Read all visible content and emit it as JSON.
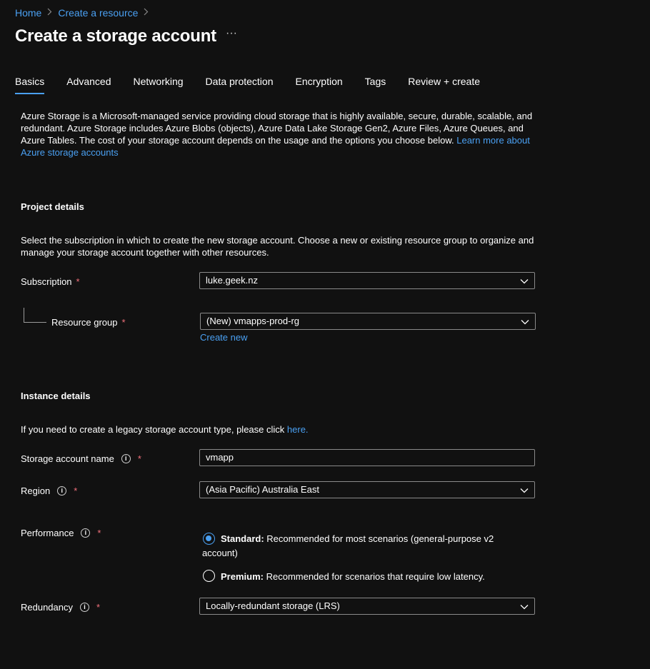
{
  "breadcrumb": {
    "home": "Home",
    "create_resource": "Create a resource"
  },
  "page": {
    "title": "Create a storage account",
    "more": "···"
  },
  "tabs": [
    {
      "label": "Basics"
    },
    {
      "label": "Advanced"
    },
    {
      "label": "Networking"
    },
    {
      "label": "Data protection"
    },
    {
      "label": "Encryption"
    },
    {
      "label": "Tags"
    },
    {
      "label": "Review + create"
    }
  ],
  "intro": {
    "line1": "Azure Storage is a Microsoft-managed service providing cloud storage that is highly available, secure, durable, scalable, and",
    "line2": "redundant. Azure Storage includes Azure Blobs (objects), Azure Data Lake Storage Gen2, Azure Files, Azure Queues, and",
    "line3": "Azure Tables. The cost of your storage account depends on the usage and the options you choose below.",
    "link_part1": "Learn more about",
    "link_part2": "Azure storage accounts"
  },
  "project": {
    "title": "Project details",
    "desc1": "Select the subscription in which to create the new storage account. Choose a new or existing resource group to organize and",
    "desc2": "manage your storage account together with other resources.",
    "subscription_label": "Subscription",
    "subscription_value": "luke.geek.nz",
    "rg_label": "Resource group",
    "rg_value": "(New) vmapps-prod-rg",
    "create_new": "Create new"
  },
  "instance": {
    "title": "Instance details",
    "legacy_text": "If you need to create a legacy storage account type, please click",
    "legacy_link": "here.",
    "name_label": "Storage account name",
    "name_value": "vmapp",
    "region_label": "Region",
    "region_value": "(Asia Pacific) Australia East",
    "performance_label": "Performance",
    "standard_title": "Standard:",
    "standard_desc1": "Recommended for most scenarios (general-purpose v2",
    "standard_desc2": "account)",
    "premium_title": "Premium:",
    "premium_desc": "Recommended for scenarios that require low latency.",
    "redundancy_label": "Redundancy",
    "redundancy_value": "Locally-redundant storage (LRS)"
  },
  "common": {
    "required": "*",
    "info": "i"
  },
  "icons": {
    "breadcrumb_sep": "chevron-right-icon",
    "dropdown": "chevron-down-icon",
    "info": "info-icon"
  },
  "colors": {
    "background": "#111111",
    "link": "#4aa0f2",
    "required": "#f1707b"
  }
}
